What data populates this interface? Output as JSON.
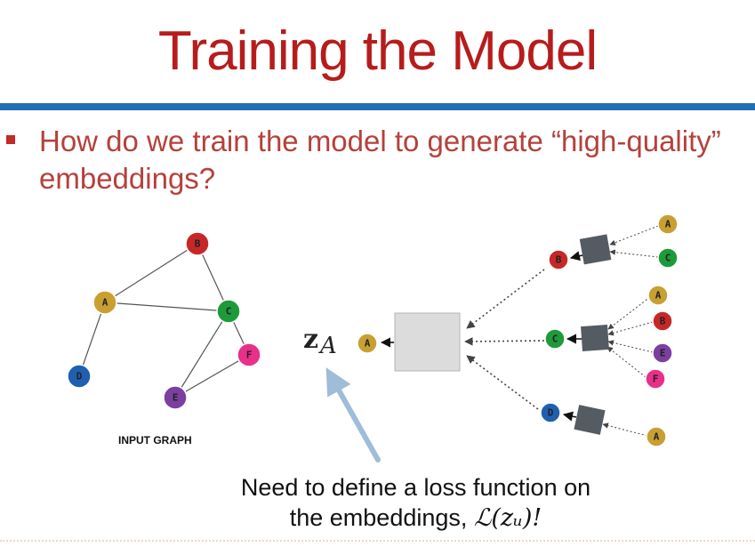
{
  "slide": {
    "title": "Training the Model",
    "question": "How do we train the model to generate “high-quality” embeddings?",
    "input_graph_label": "INPUT GRAPH",
    "embedding_symbol": "z",
    "embedding_subscript": "A",
    "caption_line1": "Need to define a loss function on",
    "caption_line2_prefix": "the embeddings, ",
    "caption_loss": "ℒ(zᵤ)!"
  },
  "colors": {
    "title": "#b71c1c",
    "rule": "#1f6fb5",
    "node_A": "#c8a032",
    "node_B": "#c62828",
    "node_C": "#1e9a3a",
    "node_D": "#1f5fb0",
    "node_E": "#7b3fa0",
    "node_F": "#e8308a",
    "arrow": "#9fbcd9"
  },
  "input_graph": {
    "nodes": [
      "A",
      "B",
      "C",
      "D",
      "E",
      "F"
    ],
    "edges": [
      [
        "A",
        "B"
      ],
      [
        "A",
        "C"
      ],
      [
        "A",
        "D"
      ],
      [
        "B",
        "C"
      ],
      [
        "C",
        "E"
      ],
      [
        "C",
        "F"
      ],
      [
        "E",
        "F"
      ]
    ]
  },
  "computation_graph": {
    "target": "A",
    "level1": [
      "B",
      "C",
      "D"
    ],
    "level2": {
      "B": [
        "A",
        "C"
      ],
      "C": [
        "A",
        "B",
        "E",
        "F"
      ],
      "D": [
        "A"
      ]
    }
  }
}
